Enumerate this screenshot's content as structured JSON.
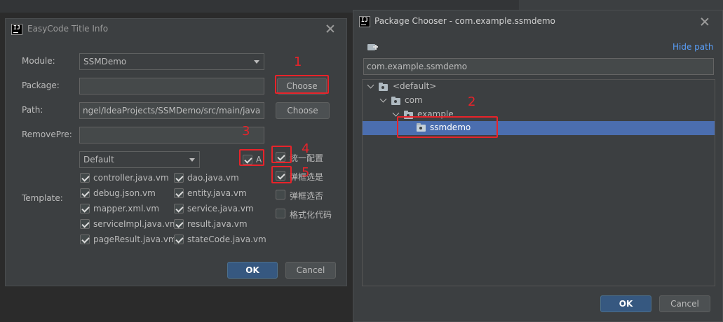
{
  "dialog1": {
    "title": "EasyCode Title Info",
    "module_label": "Module:",
    "module_value": "SSMDemo",
    "package_label": "Package:",
    "package_value": "",
    "choose_label": "Choose",
    "path_label": "Path:",
    "path_value": "ngel/IdeaProjects/SSMDemo/src/main/java",
    "choose2_label": "Choose",
    "removepre_label": "RemovePre:",
    "removepre_value": "",
    "template_group": "Default",
    "all_label": "A",
    "template_label": "Template:",
    "templates": [
      {
        "label": "controller.java.vm",
        "checked": true
      },
      {
        "label": "dao.java.vm",
        "checked": true
      },
      {
        "label": "debug.json.vm",
        "checked": true
      },
      {
        "label": "entity.java.vm",
        "checked": true
      },
      {
        "label": "mapper.xml.vm",
        "checked": true
      },
      {
        "label": "service.java.vm",
        "checked": true
      },
      {
        "label": "serviceImpl.java.vm",
        "checked": true
      },
      {
        "label": "result.java.vm",
        "checked": true
      },
      {
        "label": "pageResult.java.vm",
        "checked": true
      },
      {
        "label": "stateCode.java.vm",
        "checked": true
      }
    ],
    "options": [
      {
        "label": "统一配置",
        "checked": true
      },
      {
        "label": "弹框选是",
        "checked": true
      },
      {
        "label": "弹框选否",
        "checked": false
      },
      {
        "label": "格式化代码",
        "checked": false
      }
    ],
    "ok_label": "OK",
    "cancel_label": "Cancel"
  },
  "dialog2": {
    "title": "Package Chooser - com.example.ssmdemo",
    "hide_path_label": "Hide path",
    "path_value": "com.example.ssmdemo",
    "tree": {
      "root": "<default>",
      "com": "com",
      "example": "example",
      "ssmdemo": "ssmdemo"
    },
    "ok_label": "OK",
    "cancel_label": "Cancel"
  },
  "annotations": [
    "1",
    "2",
    "3",
    "4",
    "5"
  ],
  "colors": {
    "dialog_bg": "#3c3f41",
    "page_bg": "#2b2b2b",
    "field_bg": "#45494a",
    "selection": "#4b6eaf",
    "primary_button": "#365880",
    "link": "#589df6",
    "annotation_red": "#e8232a"
  }
}
